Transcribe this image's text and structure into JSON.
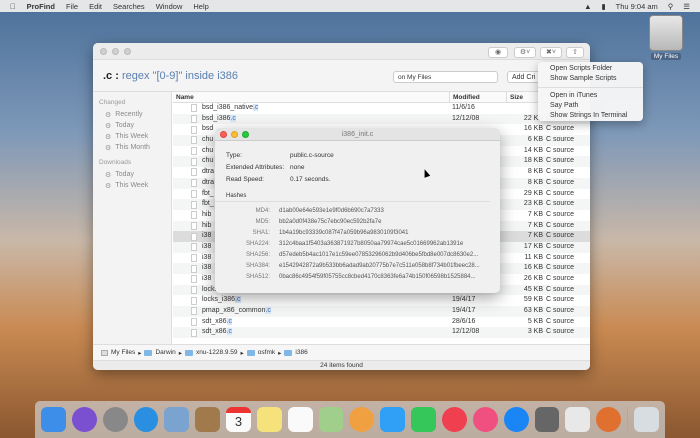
{
  "menubar": {
    "app": "ProFind",
    "items": [
      "File",
      "Edit",
      "Searches",
      "Window",
      "Help"
    ],
    "clock": "Thu 9:04 am"
  },
  "desktop": {
    "icon_label": "My Files"
  },
  "window": {
    "search": {
      "prefix": ".c",
      "sep": " : ",
      "desc": "regex \"[0-9]\" inside i386",
      "location": "on  My Files",
      "add_criteria": "Add Cri"
    },
    "sidebar": {
      "changed_header": "Changed",
      "changed": [
        "Recently",
        "Today",
        "This Week",
        "This Month"
      ],
      "downloads_header": "Downloads",
      "downloads": [
        "Today",
        "This Week"
      ]
    },
    "columns": {
      "name": "Name",
      "modified": "Modified",
      "size": "Size"
    },
    "rows": [
      {
        "name": "bsd_i386_native",
        "ext": ".c",
        "mod": "11/6/16",
        "size": "",
        "kind": ""
      },
      {
        "name": "bsd_i386",
        "ext": ".c",
        "mod": "12/12/08",
        "size": "22 KB",
        "kind": "C source"
      },
      {
        "name": "bsd",
        "ext": "",
        "mod": "",
        "size": "16 KB",
        "kind": "C source"
      },
      {
        "name": "chu",
        "ext": "",
        "mod": "",
        "size": "6 KB",
        "kind": "C source"
      },
      {
        "name": "chu",
        "ext": "",
        "mod": "",
        "size": "14 KB",
        "kind": "C source"
      },
      {
        "name": "chu",
        "ext": "",
        "mod": "",
        "size": "18 KB",
        "kind": "C source"
      },
      {
        "name": "dtra",
        "ext": "",
        "mod": "",
        "size": "8 KB",
        "kind": "C source"
      },
      {
        "name": "dtra",
        "ext": "",
        "mod": "",
        "size": "8 KB",
        "kind": "C source"
      },
      {
        "name": "fbt_",
        "ext": "",
        "mod": "",
        "size": "29 KB",
        "kind": "C source"
      },
      {
        "name": "fbt_",
        "ext": "",
        "mod": "",
        "size": "23 KB",
        "kind": "C source"
      },
      {
        "name": "hib",
        "ext": "",
        "mod": "",
        "size": "7 KB",
        "kind": "C source"
      },
      {
        "name": "hib",
        "ext": "",
        "mod": "",
        "size": "7 KB",
        "kind": "C source"
      },
      {
        "name": "i38",
        "ext": "",
        "mod": "",
        "size": "7 KB",
        "kind": "C source",
        "selected": true
      },
      {
        "name": "i38",
        "ext": "",
        "mod": "",
        "size": "17 KB",
        "kind": "C source"
      },
      {
        "name": "i38",
        "ext": "",
        "mod": "",
        "size": "11 KB",
        "kind": "C source"
      },
      {
        "name": "i38",
        "ext": "",
        "mod": "",
        "size": "16 KB",
        "kind": "C source"
      },
      {
        "name": "i38",
        "ext": "",
        "mod": "",
        "size": "26 KB",
        "kind": "C source"
      },
      {
        "name": "locks_i386",
        "ext": ".c",
        "mod": "12/12/08",
        "size": "45 KB",
        "kind": "C source"
      },
      {
        "name": "locks_i386",
        "ext": ".c",
        "mod": "19/4/17",
        "size": "59 KB",
        "kind": "C source"
      },
      {
        "name": "pmap_x86_common",
        "ext": ".c",
        "mod": "19/4/17",
        "size": "63 KB",
        "kind": "C source"
      },
      {
        "name": "sdt_x86",
        "ext": ".c",
        "mod": "28/6/16",
        "size": "5 KB",
        "kind": "C source"
      },
      {
        "name": "sdt_x86",
        "ext": ".c",
        "mod": "12/12/08",
        "size": "3 KB",
        "kind": "C source"
      }
    ],
    "path": [
      "My Files",
      "Darwin",
      "xnu-1228.9.59",
      "osfmk",
      "i386"
    ],
    "status": "24 items found"
  },
  "info_panel": {
    "title": "i386_init.c",
    "props": [
      {
        "k": "Type:",
        "v": "public.c-source"
      },
      {
        "k": "Extended Attributes:",
        "v": "none"
      },
      {
        "k": "Read Speed:",
        "v": "0.17 seconds."
      }
    ],
    "hashes_header": "Hashes",
    "hashes": [
      {
        "k": "MD4:",
        "v": "d1ab00e64e593e1e9f0d6b690c7a7333"
      },
      {
        "k": "MD5:",
        "v": "bb2a0d0f438e75c7ebc90ec592b2fa7e"
      },
      {
        "k": "SHA1:",
        "v": "1b4a19bc93339c087f47a059b96a9830109f3041"
      },
      {
        "k": "SHA224:",
        "v": "312c4baa1f5403a363871927b8050aa79974cae5c01669962ab1391e"
      },
      {
        "k": "SHA256:",
        "v": "d57edeb5b4ac1017e1c59ee07853296062b9d406be5fbd8e007dc8630e2..."
      },
      {
        "k": "SHA384:",
        "v": "e1542942872a9b533bb6adad9ab20775b7e7c511e058b8f734b01fbeec28..."
      },
      {
        "k": "SHA512:",
        "v": "0bac86c4954f59f05755cc8cbed4170c8363fe6a74b150f06598b1525884..."
      }
    ]
  },
  "tools_menu": {
    "group1": [
      "Open Scripts Folder",
      "Show Sample Scripts"
    ],
    "group2": [
      "Open in iTunes",
      "Say Path",
      "Show Strings In Terminal"
    ]
  },
  "dock": {
    "apps": [
      {
        "icon": "finder-icon",
        "color": "#3d8ee8"
      },
      {
        "icon": "siri-icon",
        "color": "#7a4fd0"
      },
      {
        "icon": "launchpad-icon",
        "color": "#888"
      },
      {
        "icon": "safari-icon",
        "color": "#2a8fe0"
      },
      {
        "icon": "preview-icon",
        "color": "#7aa3d0"
      },
      {
        "icon": "contacts-icon",
        "color": "#a07a4a"
      },
      {
        "icon": "calendar-icon",
        "color": "#fafafa"
      },
      {
        "icon": "notes-icon",
        "color": "#f5e27a"
      },
      {
        "icon": "reminders-icon",
        "color": "#fafafa"
      },
      {
        "icon": "maps-icon",
        "color": "#9fcf8a"
      },
      {
        "icon": "photos-icon",
        "color": "#f0a040"
      },
      {
        "icon": "messages-icon",
        "color": "#2fa0f5"
      },
      {
        "icon": "facetime-icon",
        "color": "#35c759"
      },
      {
        "icon": "news-icon",
        "color": "#f04050"
      },
      {
        "icon": "music-icon",
        "color": "#f05080"
      },
      {
        "icon": "app-store-icon",
        "color": "#1a85f5"
      },
      {
        "icon": "system-preferences-icon",
        "color": "#666"
      },
      {
        "icon": "screenshot-icon",
        "color": "#e8e8e8"
      },
      {
        "icon": "profind-icon",
        "color": "#e07030"
      },
      {
        "icon": "trash-icon",
        "color": "#d8dde2"
      }
    ],
    "calendar_day": "3"
  }
}
